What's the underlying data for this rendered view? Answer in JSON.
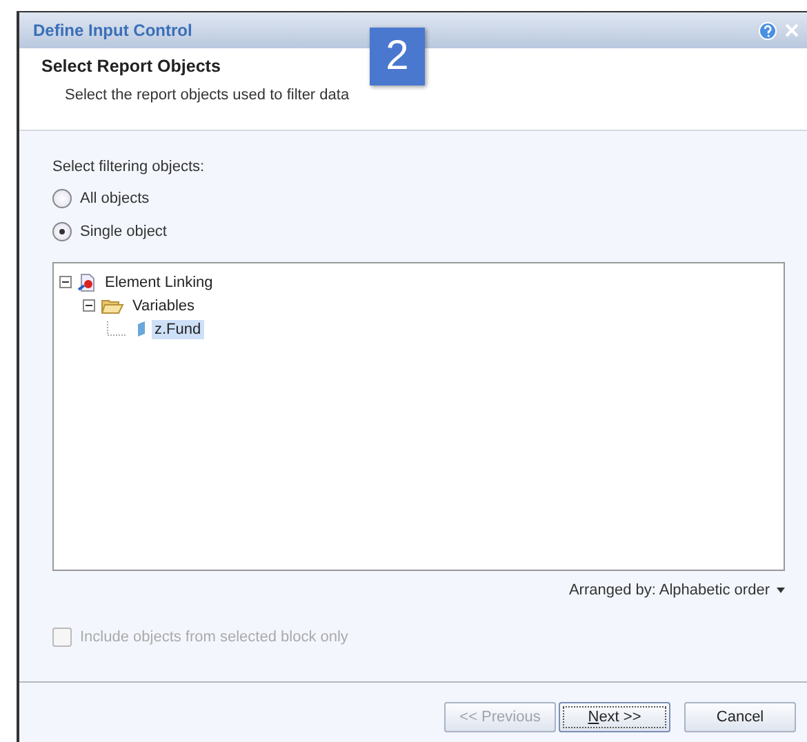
{
  "window": {
    "title": "Define Input Control"
  },
  "step_badge": "2",
  "header": {
    "title": "Select Report Objects",
    "subtitle": "Select the report objects used to filter data"
  },
  "filter_label": "Select filtering objects:",
  "radios": [
    {
      "label": "All objects",
      "selected": false
    },
    {
      "label": "Single object",
      "selected": true
    }
  ],
  "tree": [
    {
      "label": "Element Linking",
      "kind": "document",
      "expanded": true,
      "selected": false,
      "children": [
        {
          "label": "Variables",
          "kind": "folder",
          "expanded": true,
          "selected": false,
          "children": [
            {
              "label": "z.Fund",
              "kind": "variable",
              "selected": true
            }
          ]
        }
      ]
    }
  ],
  "arranged_by": "Arranged by: Alphabetic order",
  "include_checkbox": {
    "label": "Include objects from selected block only",
    "checked": false,
    "disabled": true
  },
  "buttons": [
    {
      "label": "<< Previous",
      "disabled": true,
      "default": false
    },
    {
      "label": "Next >>",
      "disabled": false,
      "default": true
    },
    {
      "label": "Cancel",
      "disabled": false,
      "default": false
    }
  ]
}
